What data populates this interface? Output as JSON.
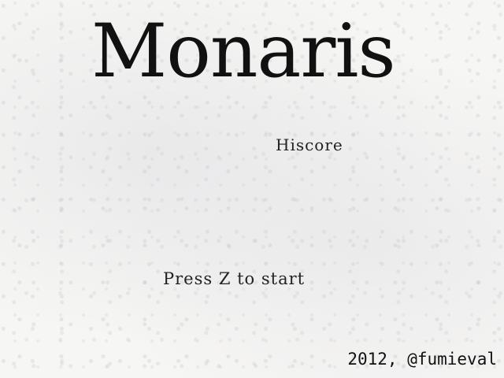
{
  "game": {
    "title": "Monaris",
    "hiscore_label": "Hiscore",
    "start_prompt": "Press Z to start",
    "credit": "2012, @fumieval"
  },
  "colors": {
    "background": "#f6f6f4",
    "text": "#111111"
  }
}
